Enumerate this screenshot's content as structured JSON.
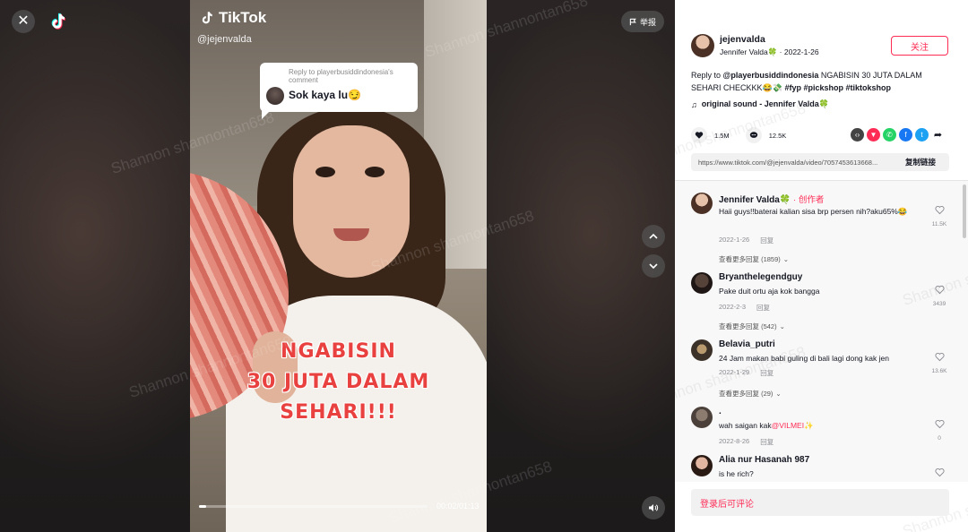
{
  "colors": {
    "accent": "#fe2c55",
    "text": "#161823",
    "muted": "#8a8b91",
    "overlay": "#e8413f"
  },
  "video": {
    "brand": "TikTok",
    "handle": "@jejenvalda",
    "report_label": "举报",
    "time": "00:02/01:13",
    "progress": 0.03,
    "reply_bubble": {
      "meta": "Reply to playerbusiddindonesia's comment",
      "text": "Sok kaya lu😏"
    },
    "overlay_lines": [
      "NGABISIN",
      "30 JUTA DALAM",
      "SEHARI!!!"
    ],
    "watermark": "Shannon shannontan658"
  },
  "author": {
    "name": "jejenvalda",
    "display": "Jennifer Valda🍀",
    "date": "2022-1-26",
    "follow_label": "关注"
  },
  "description": {
    "reply_prefix": "Reply to",
    "reply_user": "@playerbusiddindonesia",
    "text": "NGABISIN 30 JUTA DALAM SEHARI CHECKKK😂💸",
    "tags": "#fyp #pickshop #tiktokshop"
  },
  "sound": "original sound - Jennifer Valda🍀",
  "stats": {
    "likes": "1.5M",
    "comments": "12.5K"
  },
  "share_icons": [
    "embed-icon",
    "tiktok-share-icon",
    "whatsapp-icon",
    "facebook-icon",
    "twitter-icon",
    "forward-icon"
  ],
  "link": {
    "url": "https://www.tiktok.com/@jejenvalda/video/7057453613668...",
    "copy_label": "复制链接"
  },
  "comments": [
    {
      "name": "Jennifer Valda🍀",
      "creator_label": "· 创作者",
      "text": "Haii guys!!baterai kalian sisa brp persen nih?aku65%😂",
      "date": "2022-1-26",
      "reply_label": "回复",
      "likes": "11.5K",
      "more": "查看更多回复 (1859)"
    },
    {
      "name": "Bryanthelegendguy",
      "creator_label": "",
      "text": "Pake duit ortu aja kok bangga",
      "date": "2022-2-3",
      "reply_label": "回复",
      "likes": "3439",
      "more": "查看更多回复 (542)"
    },
    {
      "name": "Belavia_putri",
      "creator_label": "",
      "text": "24 Jam makan babi guling di bali lagi dong kak jen",
      "date": "2022-1-29",
      "reply_label": "回复",
      "likes": "13.6K",
      "more": "查看更多回复 (29)"
    },
    {
      "name": ".",
      "creator_label": "",
      "text_prefix": "wah saigan kak",
      "mention": "@VILMEI✨",
      "date": "2022-8-26",
      "reply_label": "回复",
      "likes": "0",
      "more": ""
    },
    {
      "name": "Alia nur Hasanah 987",
      "creator_label": "",
      "text": "is he rich?",
      "date": "",
      "reply_label": "",
      "likes": "",
      "more": ""
    }
  ],
  "login_label": "登录后可评论"
}
